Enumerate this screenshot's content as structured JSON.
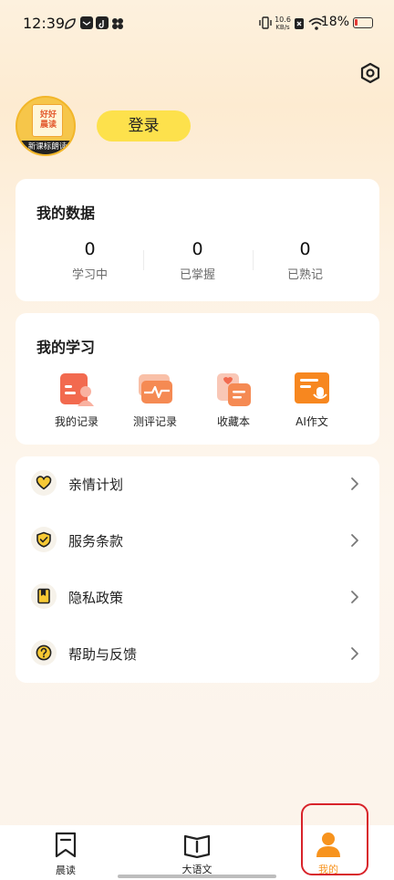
{
  "status_bar": {
    "time": "12:39",
    "net_speed_value": "10.6",
    "net_speed_unit": "KB/s",
    "battery_percent": "18%",
    "battery_level": 0.18
  },
  "profile": {
    "avatar_title": "好好\n晨读",
    "avatar_strip": "新课标朗读",
    "login_label": "登录"
  },
  "my_data": {
    "title": "我的数据",
    "stats": [
      {
        "value": "0",
        "label": "学习中"
      },
      {
        "value": "0",
        "label": "已掌握"
      },
      {
        "value": "0",
        "label": "已熟记"
      }
    ]
  },
  "my_study": {
    "title": "我的学习",
    "items": [
      {
        "label": "我的记录",
        "icon": "record-icon"
      },
      {
        "label": "测评记录",
        "icon": "evaluation-icon"
      },
      {
        "label": "收藏本",
        "icon": "favorites-icon"
      },
      {
        "label": "AI作文",
        "icon": "ai-essay-icon"
      }
    ]
  },
  "menu": [
    {
      "label": "亲情计划",
      "icon": "heart-icon"
    },
    {
      "label": "服务条款",
      "icon": "shield-check-icon"
    },
    {
      "label": "隐私政策",
      "icon": "privacy-book-icon"
    },
    {
      "label": "帮助与反馈",
      "icon": "question-icon"
    }
  ],
  "tabs": [
    {
      "label": "晨读",
      "icon": "bookmark-icon",
      "active": false
    },
    {
      "label": "大语文",
      "icon": "open-book-icon",
      "active": false
    },
    {
      "label": "我的",
      "icon": "person-icon",
      "active": true
    }
  ],
  "colors": {
    "accent": "#f7931e",
    "login_button": "#fde14c",
    "highlight_box": "#d8232a"
  }
}
